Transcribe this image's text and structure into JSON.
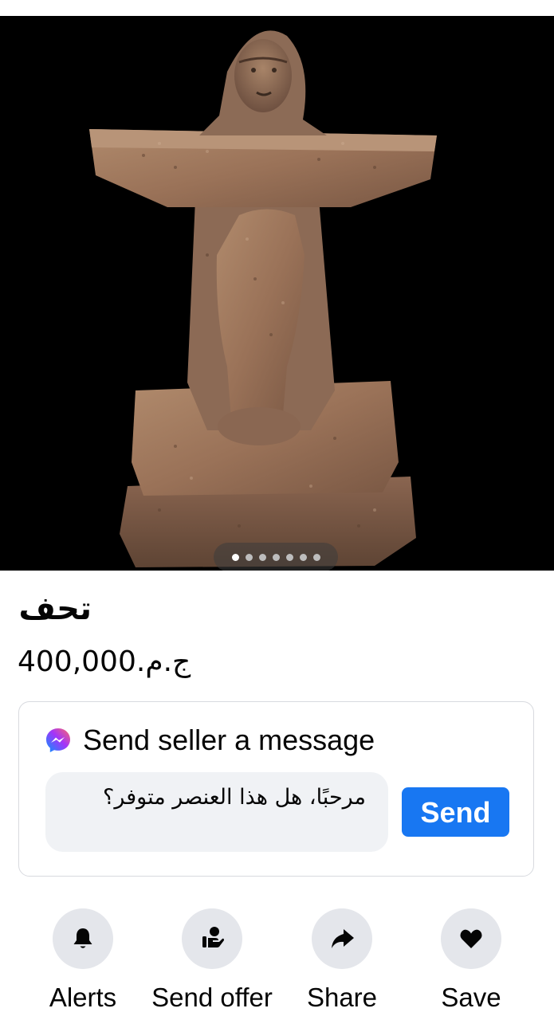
{
  "listing": {
    "title": "تحف",
    "price_amount": "400,000",
    "price_currency": "ج.م.",
    "photo": {
      "description_icon": "statue-photo",
      "carousel_count": 7,
      "carousel_active_index": 0
    }
  },
  "message_card": {
    "icon": "messenger-icon",
    "title": "Send seller a message",
    "input_value": "مرحبًا، هل هذا العنصر متوفر؟",
    "send_label": "Send",
    "send_color": "#1877f2"
  },
  "actions": [
    {
      "label": "Alerts",
      "icon": "bell-icon"
    },
    {
      "label": "Send offer",
      "icon": "offer-icon"
    },
    {
      "label": "Share",
      "icon": "share-arrow-icon"
    },
    {
      "label": "Save",
      "icon": "heart-icon"
    }
  ]
}
